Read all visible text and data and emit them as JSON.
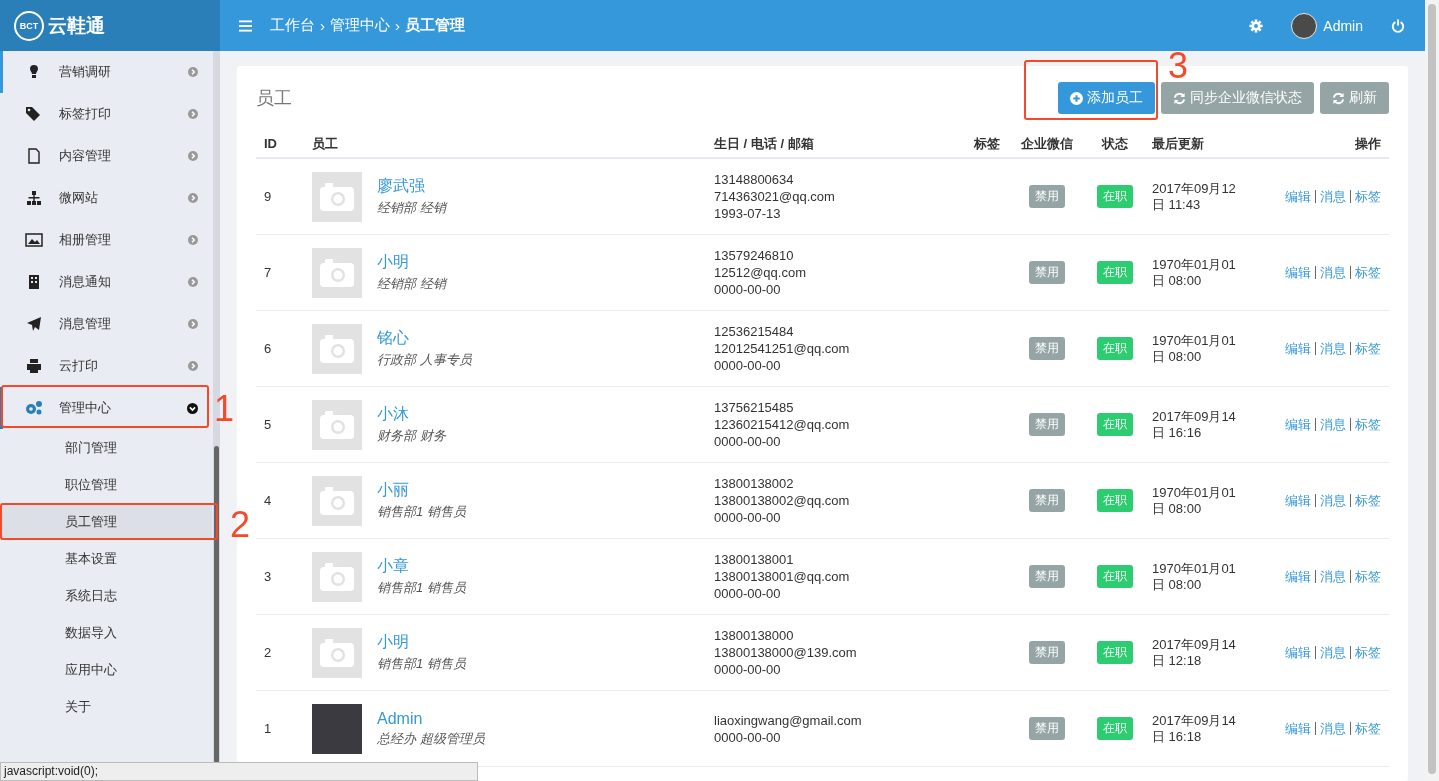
{
  "brand": {
    "name": "云鞋通",
    "logo_text": "BCT"
  },
  "breadcrumb": [
    "工作台",
    "管理中心",
    "员工管理"
  ],
  "breadcrumb_sep": "›",
  "user": {
    "name": "Admin"
  },
  "sidebar": {
    "items": [
      {
        "label": "营销调研",
        "expanded": false
      },
      {
        "label": "标签打印",
        "expanded": false
      },
      {
        "label": "内容管理",
        "expanded": false
      },
      {
        "label": "微网站",
        "expanded": false
      },
      {
        "label": "相册管理",
        "expanded": false
      },
      {
        "label": "消息通知",
        "expanded": false
      },
      {
        "label": "消息管理",
        "expanded": false
      },
      {
        "label": "云打印",
        "expanded": false
      },
      {
        "label": "管理中心",
        "expanded": true,
        "children": [
          {
            "label": "部门管理",
            "selected": false
          },
          {
            "label": "职位管理",
            "selected": false
          },
          {
            "label": "员工管理",
            "selected": true
          },
          {
            "label": "基本设置",
            "selected": false
          },
          {
            "label": "系统日志",
            "selected": false
          },
          {
            "label": "数据导入",
            "selected": false
          },
          {
            "label": "应用中心",
            "selected": false
          },
          {
            "label": "关于",
            "selected": false
          }
        ]
      }
    ]
  },
  "panel": {
    "title": "员工",
    "buttons": [
      {
        "label": "添加员工",
        "kind": "primary"
      },
      {
        "label": "同步企业微信状态",
        "kind": "sync"
      },
      {
        "label": "刷新",
        "kind": "sync"
      }
    ]
  },
  "table": {
    "columns": [
      "ID",
      "员工",
      "生日 / 电话 / 邮箱",
      "标签",
      "企业微信",
      "状态",
      "最后更新",
      "操作"
    ],
    "rows": [
      {
        "id": "9",
        "kind": "placeholder",
        "name": "廖武强",
        "dept": "经销部 经销",
        "phone": "13148800634",
        "email": "714363021@qq.com",
        "birthday": "1993-07-13",
        "wechat": "禁用",
        "status": "在职",
        "updated": "2017年09月12日 11:43",
        "actions": [
          "编辑",
          "消息",
          "标签"
        ]
      },
      {
        "id": "7",
        "kind": "placeholder",
        "name": "小明",
        "dept": "经销部 经销",
        "phone": "13579246810",
        "email": "12512@qq.com",
        "birthday": "0000-00-00",
        "wechat": "禁用",
        "status": "在职",
        "updated": "1970年01月01日 08:00",
        "actions": [
          "编辑",
          "消息",
          "标签"
        ]
      },
      {
        "id": "6",
        "kind": "placeholder",
        "name": "铭心",
        "dept": "行政部 人事专员",
        "phone": "12536215484",
        "email": "12012541251@qq.com",
        "birthday": "0000-00-00",
        "wechat": "禁用",
        "status": "在职",
        "updated": "1970年01月01日 08:00",
        "actions": [
          "编辑",
          "消息",
          "标签"
        ]
      },
      {
        "id": "5",
        "kind": "placeholder",
        "name": "小沐",
        "dept": "财务部 财务",
        "phone": "13756215485",
        "email": "12360215412@qq.com",
        "birthday": "0000-00-00",
        "wechat": "禁用",
        "status": "在职",
        "updated": "2017年09月14日 16:16",
        "actions": [
          "编辑",
          "消息",
          "标签"
        ]
      },
      {
        "id": "4",
        "kind": "placeholder",
        "name": "小丽",
        "dept": "销售部1 销售员",
        "phone": "13800138002",
        "email": "13800138002@qq.com",
        "birthday": "0000-00-00",
        "wechat": "禁用",
        "status": "在职",
        "updated": "1970年01月01日 08:00",
        "actions": [
          "编辑",
          "消息",
          "标签"
        ]
      },
      {
        "id": "3",
        "kind": "placeholder",
        "name": "小章",
        "dept": "销售部1 销售员",
        "phone": "13800138001",
        "email": "13800138001@qq.com",
        "birthday": "0000-00-00",
        "wechat": "禁用",
        "status": "在职",
        "updated": "1970年01月01日 08:00",
        "actions": [
          "编辑",
          "消息",
          "标签"
        ]
      },
      {
        "id": "2",
        "kind": "placeholder",
        "name": "小明",
        "dept": "销售部1 销售员",
        "phone": "13800138000",
        "email": "13800138000@139.com",
        "birthday": "0000-00-00",
        "wechat": "禁用",
        "status": "在职",
        "updated": "2017年09月14日 12:18",
        "actions": [
          "编辑",
          "消息",
          "标签"
        ]
      },
      {
        "id": "1",
        "kind": "photo",
        "name": "Admin",
        "dept": "总经办 超级管理员",
        "email": "liaoxingwang@gmail.com",
        "birthday": "0000-00-00",
        "wechat": "禁用",
        "status": "在职",
        "updated": "2017年09月14日 16:18",
        "actions": [
          "编辑",
          "消息",
          "标签"
        ]
      }
    ]
  },
  "annotations": [
    "1",
    "2",
    "3"
  ],
  "status_url": "javascript:void(0);"
}
